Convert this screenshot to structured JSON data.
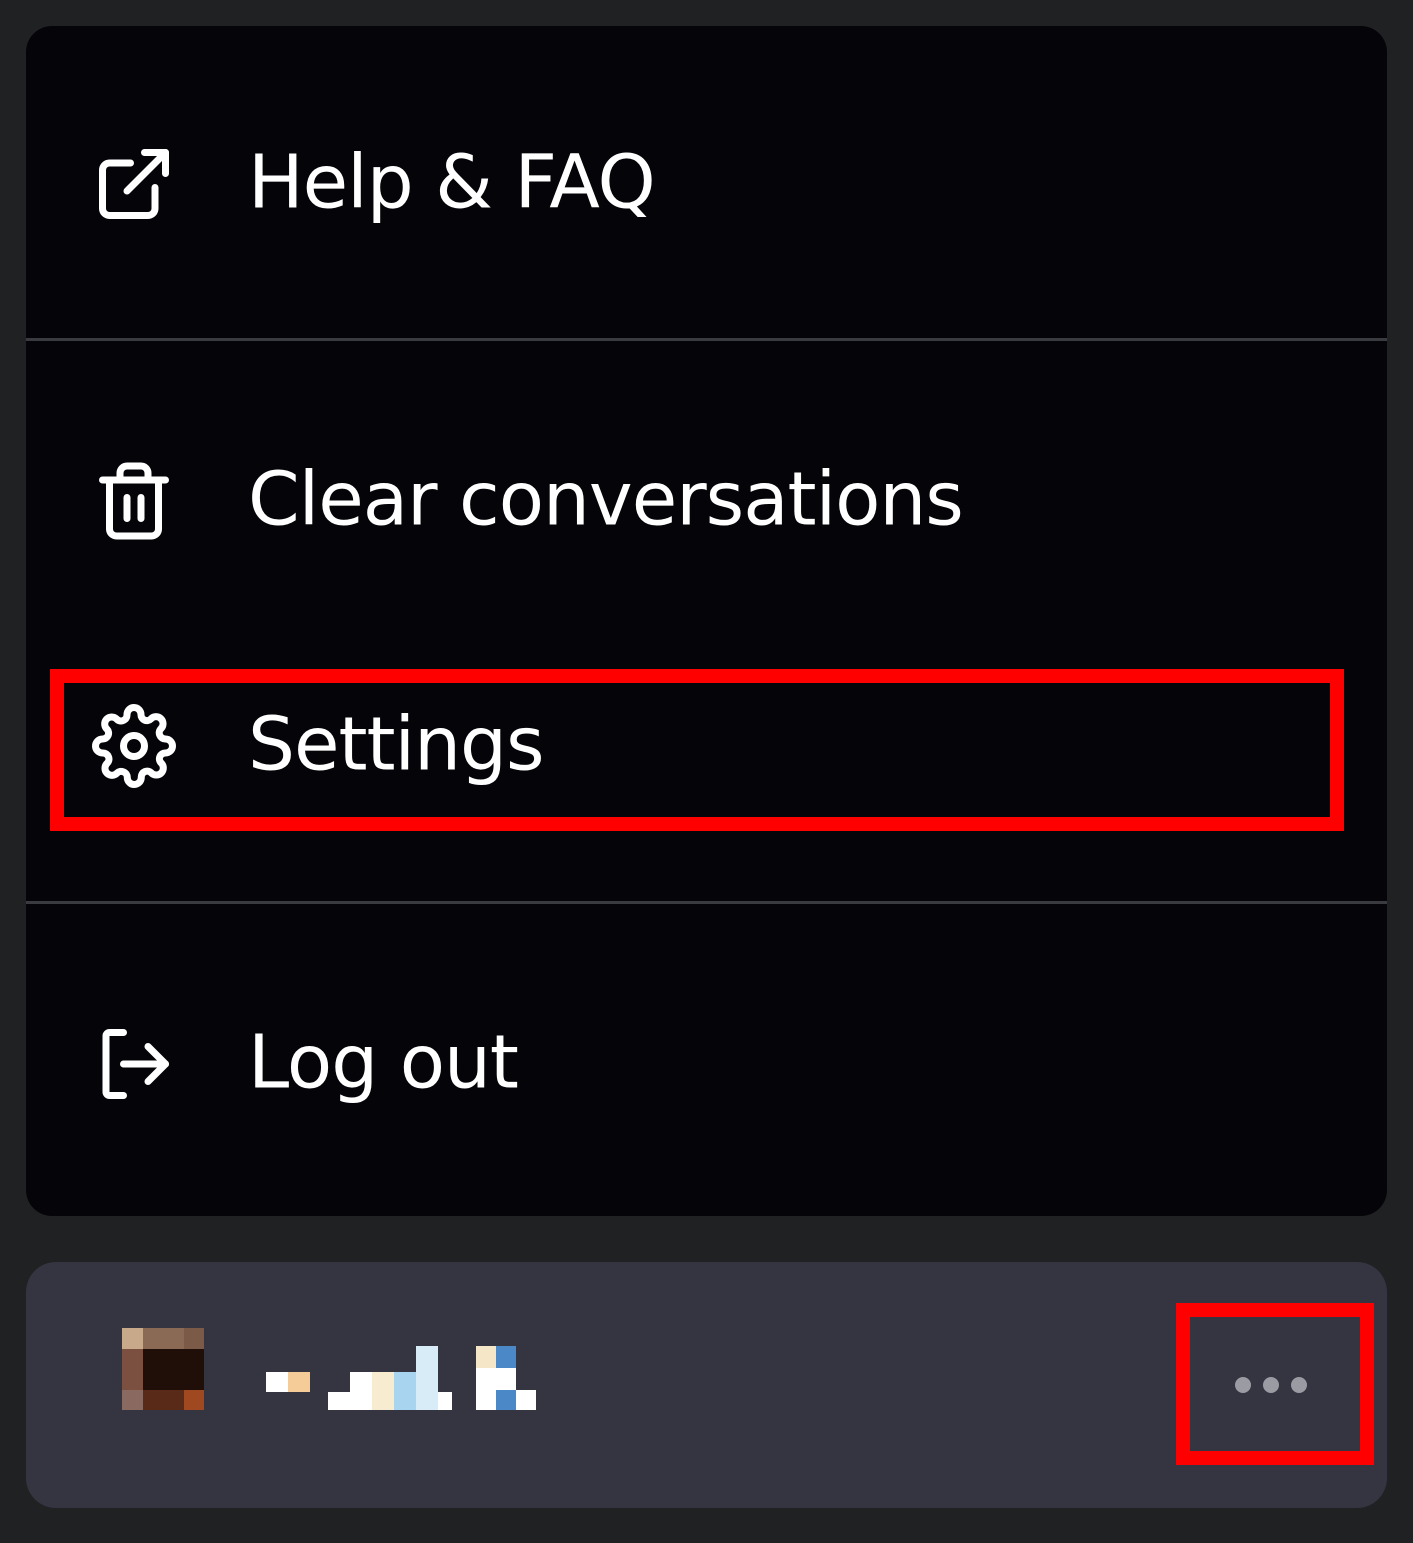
{
  "menu": {
    "items": [
      {
        "label": "Help & FAQ",
        "icon": "external-link-icon"
      },
      {
        "label": "Clear conversations",
        "icon": "trash-icon"
      },
      {
        "label": "Settings",
        "icon": "gear-icon",
        "highlighted": true
      },
      {
        "label": "Log out",
        "icon": "logout-icon"
      }
    ]
  },
  "account": {
    "avatar_icon": "avatar-icon",
    "more_icon": "more-horizontal-icon",
    "more_highlighted": true
  },
  "colors": {
    "page_bg": "#202123",
    "menu_bg": "#050509",
    "account_bg": "#343541",
    "text": "#ffffff",
    "highlight": "#ff0000"
  }
}
